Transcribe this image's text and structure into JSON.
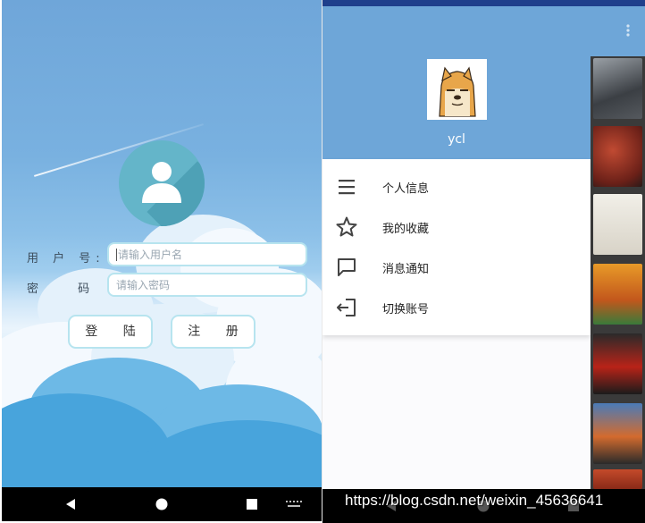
{
  "login_screen": {
    "username_label": "用 户 号:",
    "password_label": "密 码:",
    "username_placeholder": "请输入用户名",
    "password_placeholder": "请输入密码",
    "login_button": "登 陆",
    "register_button": "注 册"
  },
  "drawer": {
    "username": "ycl",
    "menu": [
      {
        "label": "个人信息",
        "icon": "menu-lines-icon"
      },
      {
        "label": "我的收藏",
        "icon": "star-icon"
      },
      {
        "label": "消息通知",
        "icon": "chat-bubble-icon"
      },
      {
        "label": "切换账号",
        "icon": "logout-icon"
      }
    ]
  },
  "watermark": "https://blog.csdn.net/weixin_45636641",
  "colors": {
    "drawer_header": "#6ea6d8",
    "field_border": "#b7e4ef",
    "avatar_circle": "#64b5c9"
  }
}
